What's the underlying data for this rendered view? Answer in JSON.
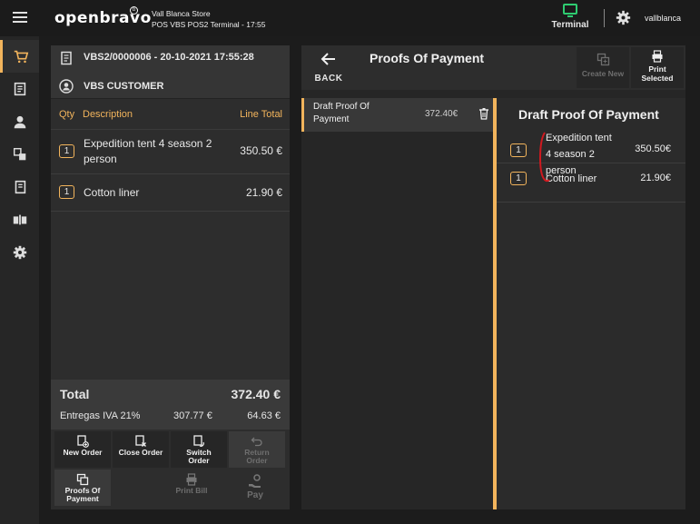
{
  "header": {
    "logo_text": "openbravo",
    "logo_mark": "b",
    "store_name": "Vall Blanca Store",
    "terminal_line": "POS VBS POS2 Terminal - 17:55",
    "terminal_label": "Terminal",
    "username": "vallblanca"
  },
  "colors": {
    "accent": "#f2b45c",
    "terminal_icon": "#2ecc71",
    "mark": "#d0191f"
  },
  "nav": [
    "cart-icon",
    "receipt-icon",
    "user-icon",
    "products-icon",
    "docs-icon",
    "cashup-icon",
    "gear-icon"
  ],
  "order": {
    "document_no": "VBS2/0000006 - 20-10-2021 17:55:28",
    "customer": "VBS CUSTOMER",
    "col_qty": "Qty",
    "col_desc": "Description",
    "col_total": "Line Total",
    "lines": [
      {
        "qty": "1",
        "desc_line1": "Expedition tent 4 season 2",
        "desc_line2": "person",
        "total": "350.50 €"
      },
      {
        "qty": "1",
        "desc_line1": "Cotton liner",
        "total": "21.90 €"
      }
    ],
    "total_label": "Total",
    "total_value": "372.40 €",
    "tax_label": "Entregas IVA 21%",
    "tax_base": "307.77 €",
    "tax_amount": "64.63 €"
  },
  "actions": {
    "new_order": "New Order",
    "close_order": "Close Order",
    "switch_order_1": "Switch",
    "switch_order_2": "Order",
    "return_order_1": "Return",
    "return_order_2": "Order",
    "proofs_1": "Proofs Of",
    "proofs_2": "Payment",
    "print_bill": "Print Bill",
    "pay": "Pay"
  },
  "pop": {
    "back": "BACK",
    "title": "Proofs Of Payment",
    "create_new": "Create New",
    "print_1": "Print",
    "print_2": "Selected",
    "draft_name_1": "Draft Proof Of",
    "draft_name_2": "Payment",
    "draft_amount": "372.40€",
    "detail_title": "Draft Proof Of Payment",
    "detail_lines": [
      {
        "qty": "1",
        "desc_1": "Expedition tent",
        "desc_2": "4 season 2",
        "desc_3": "person",
        "total": "350.50€"
      },
      {
        "qty": "1",
        "desc": "Cotton liner",
        "total": "21.90€"
      }
    ]
  }
}
